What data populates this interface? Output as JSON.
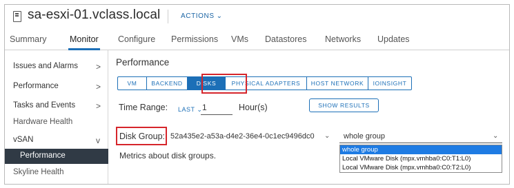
{
  "header": {
    "title": "sa-esxi-01.vclass.local",
    "actions_label": "ACTIONS",
    "host_icon": "host-server-icon",
    "actions_icon": "chevron-down-icon"
  },
  "tabs": [
    {
      "label": "Summary"
    },
    {
      "label": "Monitor"
    },
    {
      "label": "Configure"
    },
    {
      "label": "Permissions"
    },
    {
      "label": "VMs"
    },
    {
      "label": "Datastores"
    },
    {
      "label": "Networks"
    },
    {
      "label": "Updates"
    }
  ],
  "active_tab": "Monitor",
  "sidebar": {
    "items": [
      {
        "label": "Issues and Alarms",
        "arrow": ">"
      },
      {
        "label": "Performance",
        "arrow": ">"
      },
      {
        "label": "Tasks and Events",
        "arrow": ">"
      },
      {
        "label": "Hardware Health"
      },
      {
        "label": "vSAN",
        "arrow": "v"
      },
      {
        "label": "Performance"
      },
      {
        "label": "Skyline Health"
      }
    ]
  },
  "main": {
    "section_title": "Performance",
    "views": [
      "VM",
      "BACKEND",
      "DISKS",
      "PHYSICAL ADAPTERS",
      "HOST NETWORK",
      "IOINSIGHT"
    ],
    "active_view": "DISKS",
    "time_range": {
      "label": "Time Range:",
      "mode": "LAST",
      "value": "1",
      "unit": "Hour(s)",
      "show_results_label": "SHOW RESULTS"
    },
    "disk_group": {
      "label": "Disk Group:",
      "value": "52a435e2-a53a-d4e2-36e4-0c1ec9496dc0",
      "filter_value": "whole group",
      "options": [
        "whole group",
        "Local VMware Disk (mpx.vmhba0:C0:T1:L0)",
        "Local VMware Disk (mpx.vmhba0:C0:T2:L0)"
      ]
    },
    "metrics_text": "Metrics about disk groups."
  },
  "colors": {
    "accent": "#1c6fb7",
    "highlight_box": "#d6252b",
    "sidebar_active_bg": "#303a45",
    "dropdown_selected": "#1e7be3"
  }
}
